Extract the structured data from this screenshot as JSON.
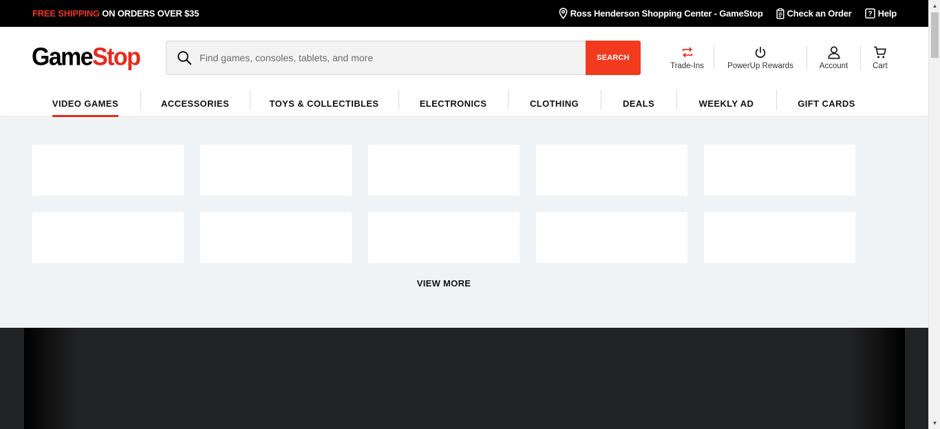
{
  "topbar": {
    "promo_highlight": "FREE SHIPPING",
    "promo_rest": " ON ORDERS OVER $35",
    "store": "Ross Henderson Shopping Center - GameStop",
    "check_order": "Check an Order",
    "help": "Help"
  },
  "header": {
    "logo_part1": "Game",
    "logo_part2": "Stop",
    "search_placeholder": "Find games, consoles, tablets, and more",
    "search_button": "SEARCH",
    "actions": {
      "trade_ins": "Trade-Ins",
      "powerup": "PowerUp Rewards",
      "account": "Account",
      "cart": "Cart"
    }
  },
  "nav": [
    {
      "label": "VIDEO GAMES",
      "active": true
    },
    {
      "label": "ACCESSORIES",
      "active": false
    },
    {
      "label": "TOYS & COLLECTIBLES",
      "active": false
    },
    {
      "label": "ELECTRONICS",
      "active": false
    },
    {
      "label": "CLOTHING",
      "active": false
    },
    {
      "label": "DEALS",
      "active": false
    },
    {
      "label": "WEEKLY AD",
      "active": false
    },
    {
      "label": "GIFT CARDS",
      "active": false
    }
  ],
  "grid": {
    "view_more": "VIEW MORE"
  },
  "colors": {
    "accent": "#e8291c",
    "search_button": "#f23a1e",
    "section_bg": "#f0f3f6",
    "dark_band": "#222325"
  },
  "icons": {
    "store": "location-pin-icon",
    "order": "clipboard-icon",
    "help": "question-box-icon",
    "search": "magnifier-icon",
    "trade_ins": "swap-arrows-icon",
    "powerup": "power-icon",
    "account": "person-icon",
    "cart": "cart-icon"
  }
}
